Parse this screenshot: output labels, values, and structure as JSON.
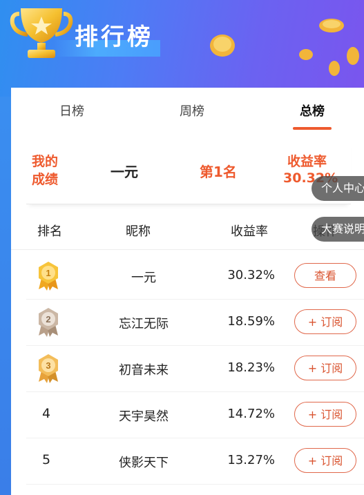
{
  "header": {
    "title": "排行榜"
  },
  "tabs": [
    {
      "label": "日榜",
      "active": false
    },
    {
      "label": "周榜",
      "active": false
    },
    {
      "label": "总榜",
      "active": true
    }
  ],
  "mine": {
    "label": "我的成绩",
    "name": "一元",
    "rank": "第1名",
    "yield_label": "收益率",
    "yield": "30.32%"
  },
  "table": {
    "headers": [
      "排名",
      "昵称",
      "收益率",
      "操作"
    ],
    "rows": [
      {
        "rank": "1",
        "medal": "gold",
        "nick": "一元",
        "yield": "30.32%",
        "action": "查看"
      },
      {
        "rank": "2",
        "medal": "silver",
        "nick": "忘江无际",
        "yield": "18.59%",
        "action": "+ 订阅"
      },
      {
        "rank": "3",
        "medal": "bronze",
        "nick": "初音未来",
        "yield": "18.23%",
        "action": "+ 订阅"
      },
      {
        "rank": "4",
        "medal": "",
        "nick": "天宇昊然",
        "yield": "14.72%",
        "action": "+ 订阅"
      },
      {
        "rank": "5",
        "medal": "",
        "nick": "侠影天下",
        "yield": "13.27%",
        "action": "+ 订阅"
      }
    ]
  },
  "floating": [
    {
      "label": "个人中心"
    },
    {
      "label": "大赛说明"
    }
  ],
  "colors": {
    "accent": "#ee5a2e",
    "header_start": "#2f8ff0",
    "header_end": "#7a55ee"
  }
}
